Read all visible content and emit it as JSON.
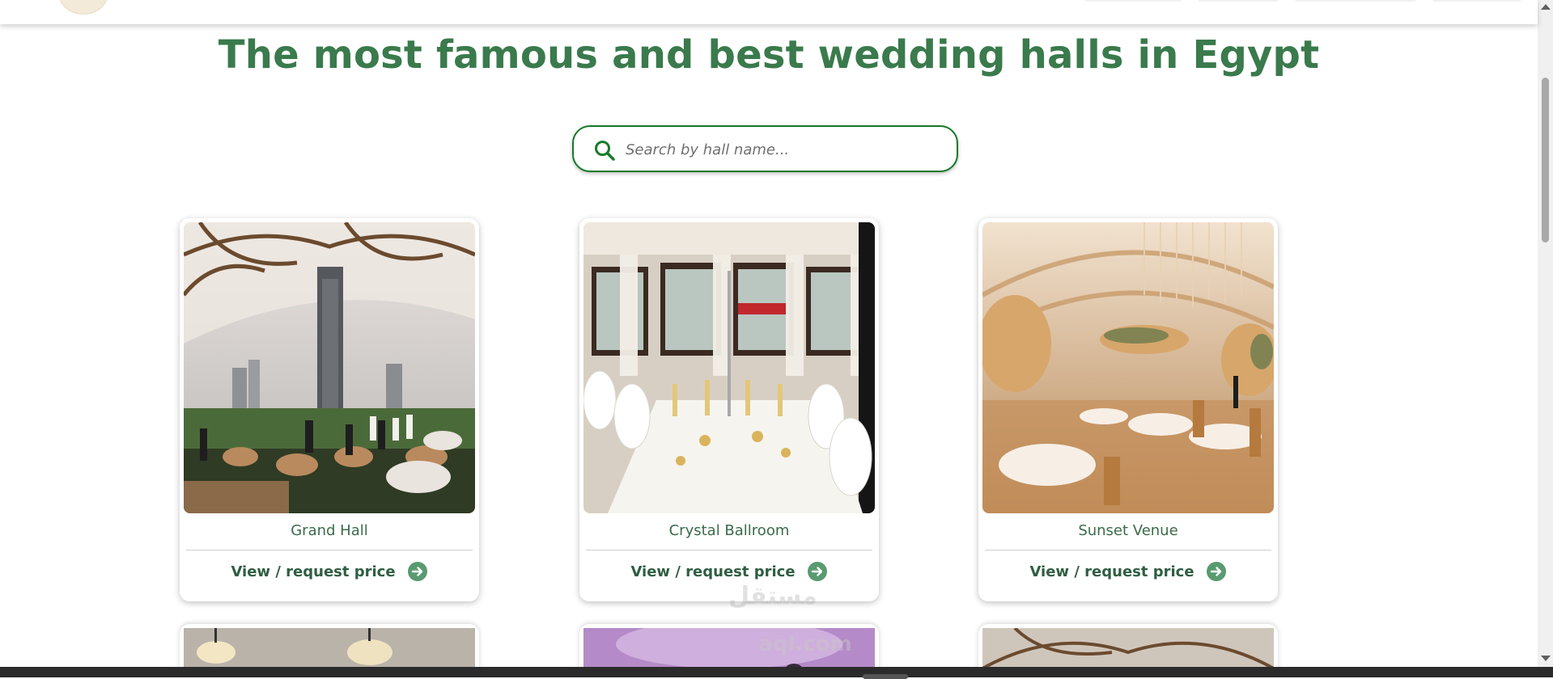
{
  "page": {
    "title": "The most famous and best wedding halls in Egypt"
  },
  "search": {
    "placeholder": "Search by hall name...",
    "value": ""
  },
  "halls": [
    {
      "name": "Grand Hall",
      "link": "View / request price"
    },
    {
      "name": "Crystal Ballroom",
      "link": "View / request price"
    },
    {
      "name": "Sunset Venue",
      "link": "View / request price"
    }
  ],
  "watermark": {
    "text": "مستقل",
    "sub": "aql.com"
  },
  "colors": {
    "accent": "#3a7a4c",
    "search_border": "#157a2a",
    "link": "#2f5e42",
    "arrow_circle": "#5a9a70"
  },
  "icons": {
    "search": "search-icon",
    "arrow": "arrow-right-circle-icon"
  }
}
